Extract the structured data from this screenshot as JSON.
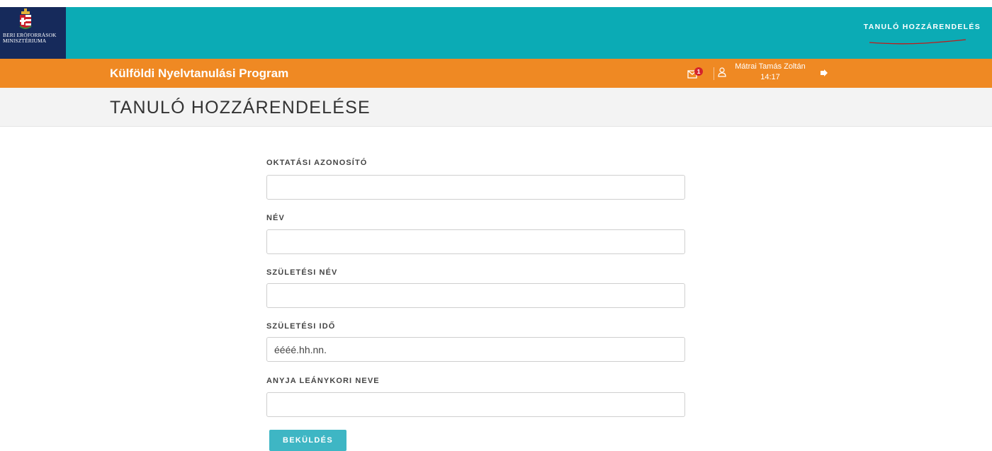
{
  "header": {
    "logo_lines": [
      "BERI ERŐFORRÁSOK",
      "MINISZTÉRIUMA"
    ],
    "nav_link": "TANULÓ HOZZÁRENDELÉS"
  },
  "subheader": {
    "program_title": "Külföldi Nyelvtanulási Program",
    "mail_badge": "1",
    "user_name": "Mátrai Tamás Zoltán",
    "time": "14:17"
  },
  "page": {
    "title": "TANULÓ HOZZÁRENDELÉSE"
  },
  "form": {
    "fields": [
      {
        "label": "OKTATÁSI AZONOSÍTÓ",
        "value": "",
        "placeholder": ""
      },
      {
        "label": "NÉV",
        "value": "",
        "placeholder": ""
      },
      {
        "label": "SZÜLETÉSI NÉV",
        "value": "",
        "placeholder": ""
      },
      {
        "label": "SZÜLETÉSI IDŐ",
        "value": "",
        "placeholder": "éééé.hh.nn."
      },
      {
        "label": "ANYJA LEÁNYKORI NEVE",
        "value": "",
        "placeholder": ""
      }
    ],
    "submit_label": "BEKÜLDÉS"
  },
  "colors": {
    "teal": "#0babb5",
    "navy": "#162a5b",
    "orange": "#ef8923",
    "button": "#3eb6c4",
    "badge": "#d4242c"
  },
  "icons": [
    "crest-icon",
    "mail-icon",
    "user-icon",
    "logout-icon"
  ]
}
